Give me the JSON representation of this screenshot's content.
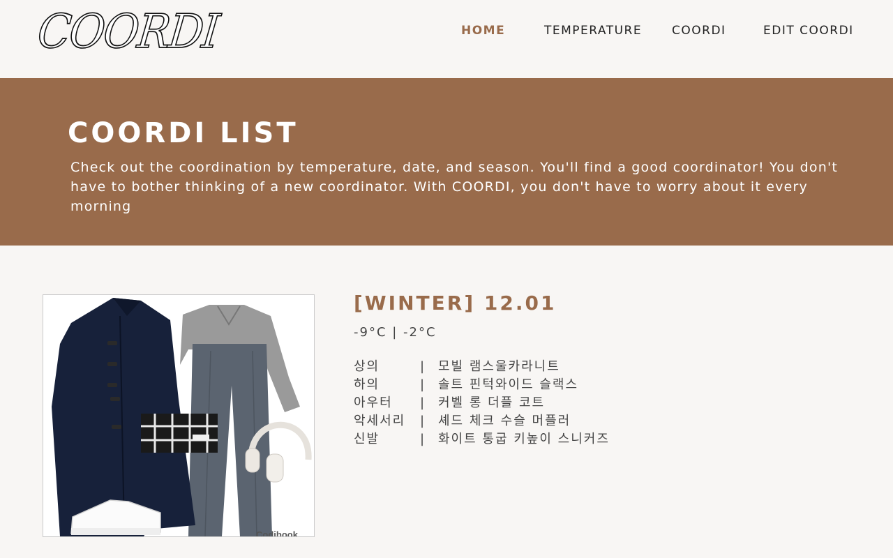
{
  "header": {
    "logo": "COORDI",
    "nav": [
      {
        "label": "HOME",
        "active": true
      },
      {
        "label": "TEMPERATURE",
        "active": false
      },
      {
        "label": "COORDI",
        "active": false
      },
      {
        "label": "EDIT COORDI",
        "active": false
      }
    ]
  },
  "banner": {
    "title": "COORDI LIST",
    "description": "Check out the coordination by temperature, date, and season. You'll find a good coordinator! You don't have to bother thinking of a new coordinator. With COORDI, you don't have to worry about it every morning"
  },
  "entry": {
    "title": "[WINTER] 12.01",
    "temperature": "-9°C | -2°C",
    "separator": "|",
    "items": [
      {
        "category": "상의",
        "name": "모빌 램스울카라니트"
      },
      {
        "category": "하의",
        "name": "솔트 핀턱와이드 슬랙스"
      },
      {
        "category": "아우터",
        "name": "커벨 롱 더플 코트"
      },
      {
        "category": "악세서리",
        "name": "셰드 체크 수슬 머플러"
      },
      {
        "category": "신발",
        "name": "화이트 통굽 키높이 스니커즈"
      }
    ],
    "image_watermark": "Codibook"
  },
  "colors": {
    "accent": "#996b4b",
    "background": "#f8f6f4",
    "text": "#333333"
  }
}
